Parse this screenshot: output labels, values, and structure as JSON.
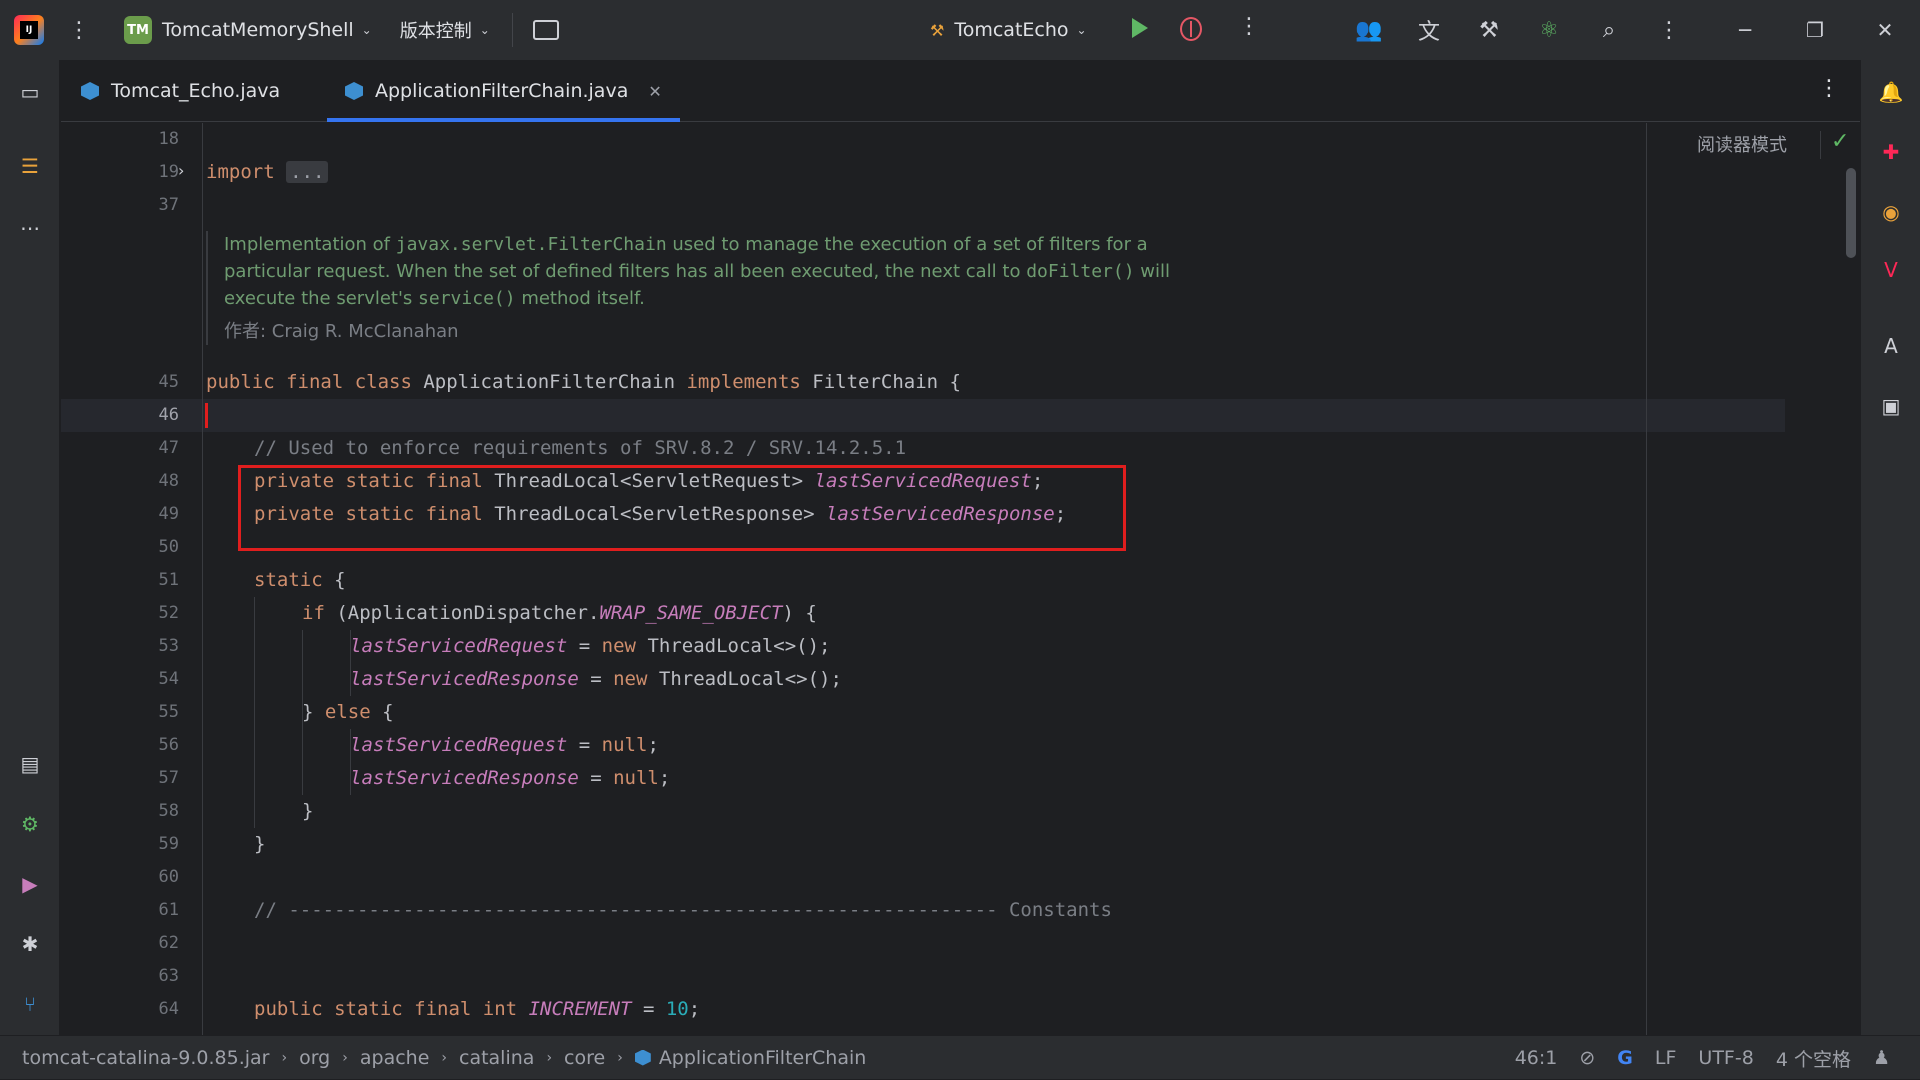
{
  "titlebar": {
    "project_badge": "TM",
    "project_name": "TomcatMemoryShell",
    "vcs_label": "版本控制",
    "run_config": "TomcatEcho"
  },
  "tabs": [
    {
      "label": "Tomcat_Echo.java",
      "active": false
    },
    {
      "label": "ApplicationFilterChain.java",
      "active": true
    }
  ],
  "editor": {
    "reader_mode": "阅读器模式",
    "line_numbers": {
      "l18": "18",
      "l19": "19",
      "l37": "37",
      "l45": "45",
      "l46": "46",
      "l47": "47",
      "l48": "48",
      "l49": "49",
      "l50": "50",
      "l51": "51",
      "l52": "52",
      "l53": "53",
      "l54": "54",
      "l55": "55",
      "l56": "56",
      "l57": "57",
      "l58": "58",
      "l59": "59",
      "l60": "60",
      "l61": "61",
      "l62": "62",
      "l63": "63",
      "l64": "64"
    },
    "import_kw": "import",
    "import_dots": "...",
    "doc": {
      "t1": "Implementation of ",
      "c1": "javax.servlet.FilterChain",
      "t2": " used to manage the execution of a set of filters for a particular request. When the set of defined filters has all been executed, the next call to ",
      "c2": "doFilter()",
      "t3": " will execute the servlet's ",
      "c3": "service()",
      "t4": " method itself.",
      "author": "作者: Craig R. McClanahan"
    },
    "code": {
      "l45": {
        "kw": "public final class",
        "name": " ApplicationFilterChain ",
        "kw2": "implements",
        "rest": " FilterChain {"
      },
      "l47": "// Used to enforce requirements of SRV.8.2 / SRV.14.2.5.1",
      "l48": {
        "kw": "private static final",
        "type": " ThreadLocal<ServletRequest> ",
        "field": "lastServicedRequest",
        "end": ";"
      },
      "l49": {
        "kw": "private static final",
        "type": " ThreadLocal<ServletResponse> ",
        "field": "lastServicedResponse",
        "end": ";"
      },
      "l51": {
        "kw": "static",
        "rest": " {"
      },
      "l52": {
        "kw": "if",
        "a": " (ApplicationDispatcher.",
        "field": "WRAP_SAME_OBJECT",
        "b": ") {"
      },
      "l53": {
        "field": "lastServicedRequest",
        "a": " = ",
        "kw": "new",
        "b": " ThreadLocal<>();"
      },
      "l54": {
        "field": "lastServicedResponse",
        "a": " = ",
        "kw": "new",
        "b": " ThreadLocal<>();"
      },
      "l55": {
        "a": "} ",
        "kw": "else",
        "b": " {"
      },
      "l56": {
        "field": "lastServicedRequest",
        "a": " = ",
        "kw": "null",
        "b": ";"
      },
      "l57": {
        "field": "lastServicedResponse",
        "a": " = ",
        "kw": "null",
        "b": ";"
      },
      "l58": "}",
      "l59": "}",
      "l61": "// -------------------------------------------------------------- Constants",
      "l64": {
        "kw": "public static final int",
        "field": "INCREMENT",
        "a": " = ",
        "num": "10",
        "b": ";"
      }
    }
  },
  "statusbar": {
    "breadcrumb": [
      "tomcat-catalina-9.0.85.jar",
      "org",
      "apache",
      "catalina",
      "core",
      "ApplicationFilterChain"
    ],
    "position": "46:1",
    "line_sep": "LF",
    "encoding": "UTF-8",
    "indent": "4 个空格"
  },
  "colors": {
    "accent": "#3574f0",
    "keyword": "#cf8e6d",
    "field": "#c77dbb",
    "number": "#2aacb8",
    "comment": "#7a7e85",
    "doc": "#6f9c71",
    "highlight_box": "#e01e1e"
  }
}
